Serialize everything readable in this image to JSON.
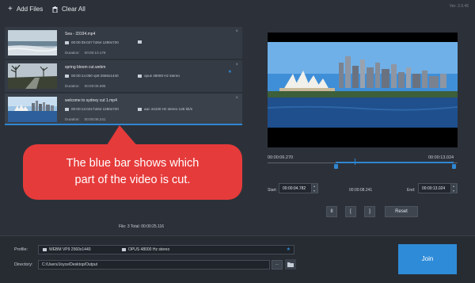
{
  "toolbar": {
    "add_files": "Add Files",
    "add_icon": "plus-icon",
    "clear_all": "Clear All",
    "clear_icon": "trash-icon",
    "version": "Ver: 2.0.46"
  },
  "files": [
    {
      "name": "Sea - 33194.mp4",
      "video_info": "00:00:39.027 h264 1280x720",
      "audio_info": "",
      "duration_label": "Duration:",
      "duration": "00:00:10.178"
    },
    {
      "name": "spring bloom cut.webm",
      "video_info": "00:00:14.050 vp8 2560x1440",
      "audio_info": "opus 48000 Hz stereo",
      "duration_label": "Duration:",
      "duration": "00:00:06.695"
    },
    {
      "name": "welcome to sydney cut 1.mp4",
      "video_info": "00:00:13.024 h264 1280x720",
      "audio_info": "aac 44100 Hz stereo  126 kb/s",
      "duration_label": "Duration:",
      "duration": "00:00:08.241"
    }
  ],
  "callout": {
    "line1": "The blue bar shows which",
    "line2": "part of the video is cut."
  },
  "timeline": {
    "start_time": "00:00:06.270",
    "end_time": "00:00:13.024",
    "selection_start_fraction": 0.36,
    "selection_end_fraction": 0.98,
    "playhead_fraction": 0.46
  },
  "trim": {
    "start_label": "Start:",
    "start_value": "00:00:04.782",
    "duration_value": "00:00:08.241",
    "end_label": "End:",
    "end_value": "00:00:13.024"
  },
  "controls": {
    "pause": "II",
    "mark_in": "[",
    "mark_out": "]",
    "reset": "Reset"
  },
  "summary": "File: 3   Total: 00:00:25.116",
  "output": {
    "profile_label": "Profile:",
    "profile_video": "WEBM VP9 2560x1440",
    "profile_audio": "OPUS 48000 Hz stereo",
    "directory_label": "Directory:",
    "directory_value": "C:/Users/Joyce/Desktop/Output",
    "browse": "...",
    "join": "Join"
  },
  "colors": {
    "accent": "#2f87d2",
    "callout": "#e63b3b",
    "background": "#2c3139"
  }
}
